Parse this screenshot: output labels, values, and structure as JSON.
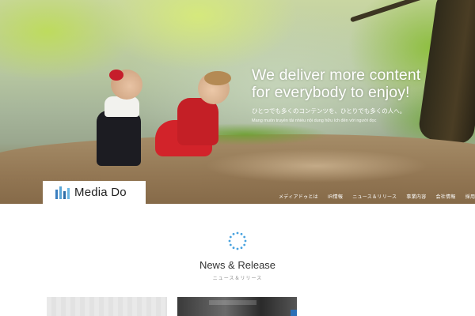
{
  "hero": {
    "headline_line1": "We deliver more content",
    "headline_line2": "for everybody to enjoy!",
    "subtitle_jp": "ひとつでも多くのコンテンツを、ひとりでも多くの人へ。",
    "subtitle_vn": "Mang muốn truyền tải nhiều nội dung hữu ích đến với người đọc"
  },
  "logo": {
    "text": "Media Do",
    "icon": "bars-logo-icon",
    "colors": [
      "#3b7fbf",
      "#5aa7d8",
      "#2f6fa8",
      "#6bb7e3"
    ]
  },
  "nav": {
    "items": [
      {
        "label": "メディアドゥとは"
      },
      {
        "label": "IR情報"
      },
      {
        "label": "ニュース＆リリース"
      },
      {
        "label": "事業内容"
      },
      {
        "label": "会社情報"
      },
      {
        "label": "採用情報"
      }
    ]
  },
  "section": {
    "title": "News & Release",
    "subtitle": "ニュース＆リリース",
    "spinner_icon": "loading-spinner-icon",
    "accent_color": "#4aa3df"
  }
}
